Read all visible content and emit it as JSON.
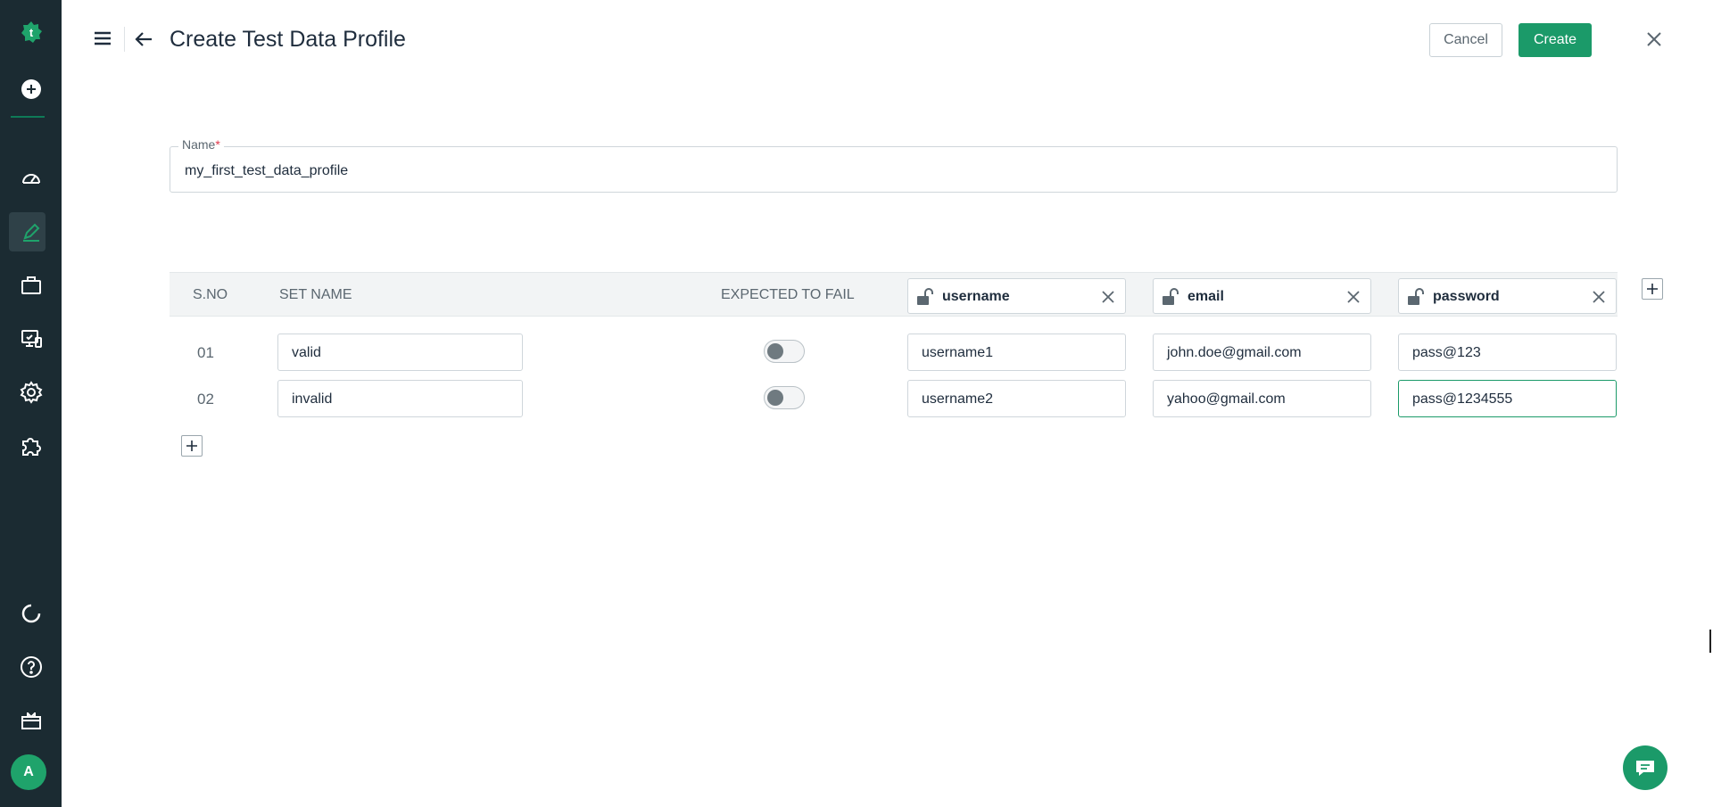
{
  "header": {
    "title": "Create Test Data Profile",
    "cancel_label": "Cancel",
    "create_label": "Create"
  },
  "name_field": {
    "label": "Name",
    "required_mark": "*",
    "value": "my_first_test_data_profile"
  },
  "table": {
    "columns": {
      "sno": "S.NO",
      "set_name": "SET NAME",
      "expected_to_fail": "EXPECTED TO FAIL"
    },
    "parameters": [
      "username",
      "email",
      "password"
    ],
    "rows": [
      {
        "sno": "01",
        "set_name": "valid",
        "expected_to_fail": false,
        "values": [
          "username1",
          "john.doe@gmail.com",
          "pass@123"
        ]
      },
      {
        "sno": "02",
        "set_name": "invalid",
        "expected_to_fail": false,
        "values": [
          "username2",
          "yahoo@gmail.com",
          "pass@1234555"
        ]
      }
    ]
  },
  "sidebar": {
    "avatar_initial": "A",
    "items": [
      "logo-icon",
      "add-icon",
      "dashboard-icon",
      "test-development-icon",
      "briefcase-icon",
      "run-results-icon",
      "settings-icon",
      "addons-icon",
      "refresh-icon",
      "help-icon",
      "gift-icon"
    ]
  },
  "colors": {
    "sidebar_bg": "#1b2b32",
    "accent": "#1b9a69",
    "required": "#e0384b"
  }
}
